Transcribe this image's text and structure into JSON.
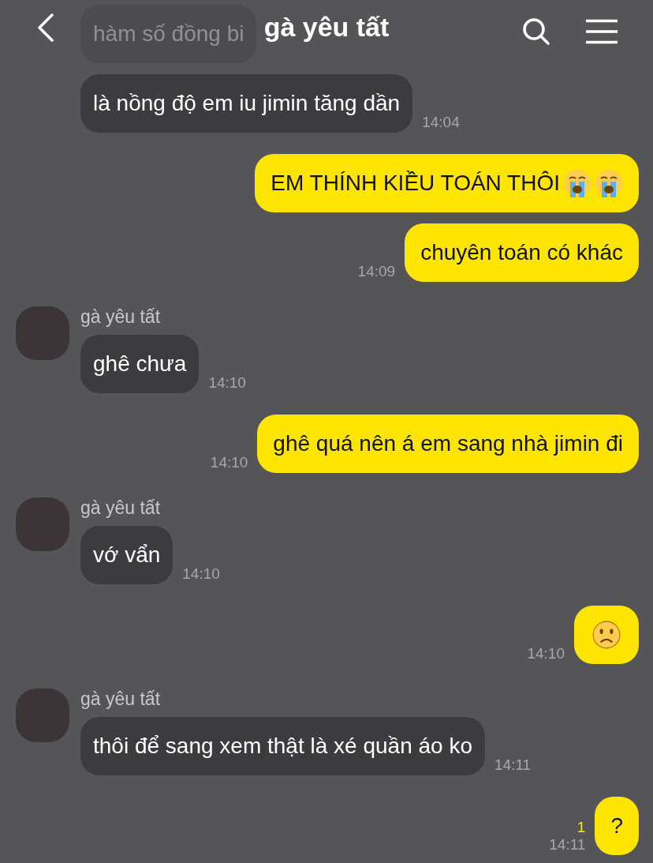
{
  "header": {
    "title": "gà yêu tất"
  },
  "messages": [
    {
      "kind": "incoming",
      "text": "hàm số đồng bi",
      "faded": true
    },
    {
      "kind": "incoming",
      "text": "là nồng độ em iu jimin tăng dần",
      "time": "14:04"
    },
    {
      "kind": "outgoing",
      "text": "EM THÍNH KIỀU TOÁN THÔI",
      "emojis": [
        {
          "kind": "crying"
        },
        {
          "kind": "crying"
        }
      ]
    },
    {
      "kind": "outgoing",
      "text": "chuyên toán có khác",
      "time": "14:09"
    },
    {
      "kind": "incoming",
      "sender": "gà yêu tất",
      "text": "ghê chưa",
      "time": "14:10"
    },
    {
      "kind": "outgoing",
      "text": "ghê quá nên á em sang nhà jimin đi",
      "time": "14:10"
    },
    {
      "kind": "incoming",
      "sender": "gà yêu tất",
      "text": "vớ vẩn",
      "time": "14:10"
    },
    {
      "kind": "outgoing",
      "emojis": [
        {
          "kind": "frowning"
        }
      ],
      "time": "14:10"
    },
    {
      "kind": "incoming",
      "sender": "gà yêu tất",
      "text": "thôi để sang xem thật là xé quần áo ko",
      "time": "14:11"
    },
    {
      "kind": "outgoing",
      "text": "?",
      "unread": "1",
      "time": "14:11"
    }
  ]
}
